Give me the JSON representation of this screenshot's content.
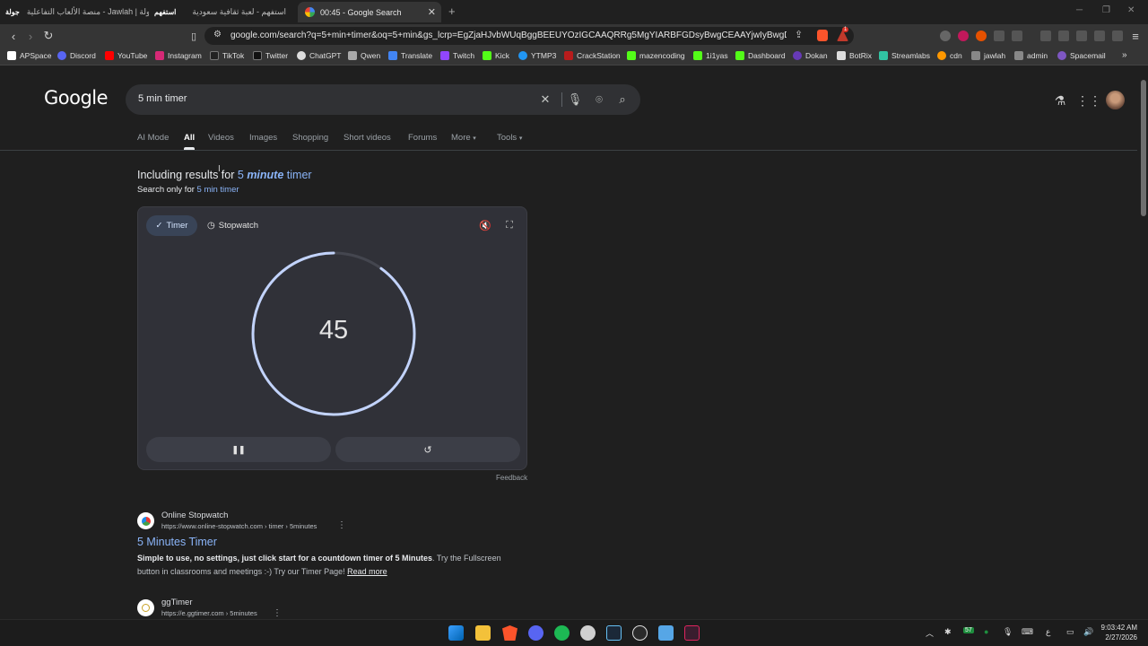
{
  "browser": {
    "tabs": [
      {
        "label": "جولة | Jawlah - منصة الألعاب التفاعلية",
        "favicon_label": "جولة"
      },
      {
        "label": "استفهم - لعبة ثقافية سعودية",
        "favicon_label": "استفهم"
      },
      {
        "label": "00:45 - Google Search",
        "active": true
      }
    ],
    "new_tab": "+",
    "url": "google.com/search?q=5+min+timer&oq=5+min&gs_lcrp=EgZjaHJvbWUqBggBEEUYOzIGCAAQRRg5MgYIARBFGDsyBwgCEAAYjwIyBwgDEAAYjwIyB...",
    "extension_badge": "1"
  },
  "bookmarks": [
    "APSpace",
    "Discord",
    "YouTube",
    "Instagram",
    "TikTok",
    "Twitter",
    "ChatGPT",
    "Qwen",
    "Translate",
    "Twitch",
    "Kick",
    "YTMP3",
    "CrackStation",
    "mazencoding",
    "1i1yas",
    "Dashboard",
    "Dokan",
    "BotRix",
    "Streamlabs",
    "cdn",
    "jawlah",
    "admin",
    "Spacemail"
  ],
  "google": {
    "logo": "Google",
    "query": "5 min timer",
    "nav_tabs": [
      "AI Mode",
      "All",
      "Videos",
      "Images",
      "Shopping",
      "Short videos",
      "Forums",
      "More",
      "Tools"
    ],
    "active_tab": "All"
  },
  "correction": {
    "prefix": "Including results for",
    "part1": "5",
    "part2": "minute",
    "part3": "timer",
    "search_only_prefix": "Search only for",
    "search_only_query": "5 min timer"
  },
  "timer_widget": {
    "chip_timer": "Timer",
    "chip_stopwatch": "Stopwatch",
    "countdown": "45",
    "remaining_fraction": 0.9,
    "feedback": "Feedback"
  },
  "results": [
    {
      "site": "Online Stopwatch",
      "url": "https://www.online-stopwatch.com › timer › 5minutes",
      "title": "5 Minutes Timer",
      "snippet_bold": "Simple to use, no settings, just click start for a countdown timer of 5 Minutes",
      "snippet_rest": ". Try the Fullscreen button in classrooms and meetings :-) Try our Timer Page!",
      "read_more": "Read more"
    },
    {
      "site": "ggTimer",
      "url": "https://e.ggtimer.com › 5minutes"
    }
  ],
  "taskbar": {
    "lang": "ع",
    "time": "9:03:42 AM",
    "date": "2/27/2026",
    "tray_badge": "57"
  },
  "colors": {
    "accent_link": "#8ab4f8",
    "ring": "#c2d3fb",
    "background": "#1f1f1f"
  }
}
